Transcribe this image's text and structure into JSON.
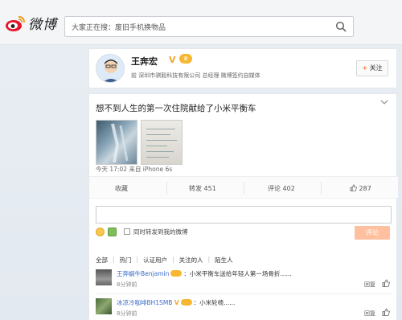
{
  "header": {
    "logo_text": "微博",
    "search_placeholder": "大家正在搜：废旧手机换物品"
  },
  "profile": {
    "name": "王奔宏",
    "verified": "V",
    "description": "前 深圳市骐毅科技有限公司 总经理 微博签约自媒体",
    "follow_label": "关注"
  },
  "post": {
    "text": "想不到人生的第一次住院献给了小米平衡车",
    "meta": "今天 17:02 来自 iPhone 6s",
    "actions": {
      "favorite": "收藏",
      "repost_label": "转发",
      "repost_count": "451",
      "comment_label": "评论",
      "comment_count": "402",
      "like_count": "287"
    }
  },
  "comment_form": {
    "placeholder": "",
    "repost_checkbox_label": "同时转发到我的微博",
    "submit_label": "评论"
  },
  "filters": [
    "全部",
    "热门",
    "认证用户",
    "关注的人",
    "陌生人"
  ],
  "comments": [
    {
      "author": "王奔蜗牛Benjamin",
      "text": "：小米平衡车送给年轻人第一场骨折......",
      "time": "8分钟前",
      "reply": "回复"
    },
    {
      "author": "冰凉冷咖啡BH1SMB",
      "text": "：小米轮椅......",
      "time": "8分钟前",
      "reply": "回复"
    }
  ],
  "colors": {
    "accent": "#ff8140",
    "link": "#3b6bc9",
    "submit_disabled": "#ffc09f"
  }
}
